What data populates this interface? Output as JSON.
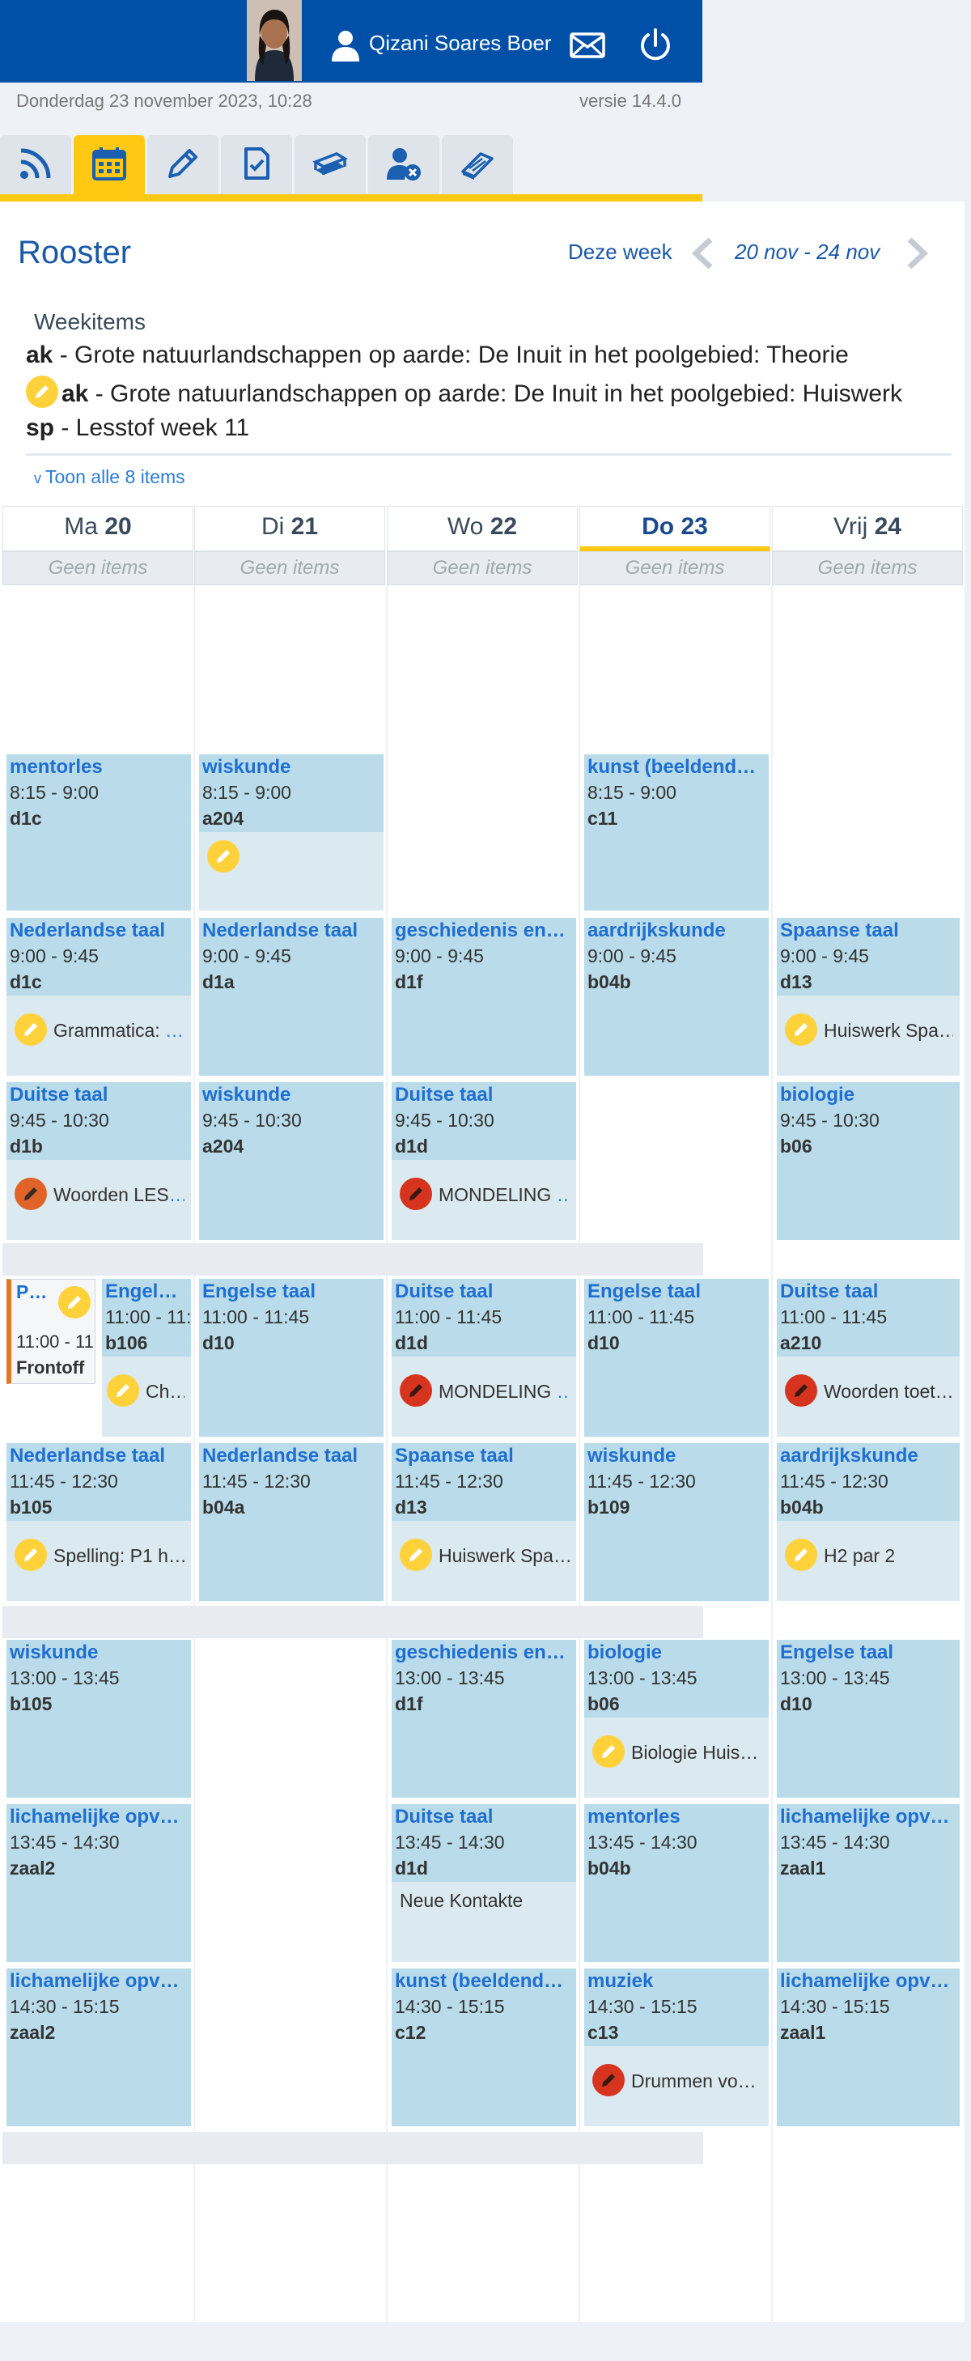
{
  "header": {
    "user_name": "Qizani Soares Boer",
    "date_time": "Donderdag 23 november 2023, 10:28",
    "version": "versie 14.4.0"
  },
  "nav_tabs": [
    {
      "icon": "rss-icon"
    },
    {
      "icon": "calendar-icon",
      "active": true
    },
    {
      "icon": "pencil-icon"
    },
    {
      "icon": "checklist-icon"
    },
    {
      "icon": "books-icon"
    },
    {
      "icon": "absence-icon"
    },
    {
      "icon": "book-icon"
    }
  ],
  "rooster": {
    "title": "Rooster",
    "this_week": "Deze week",
    "week_range": "20 nov - 24 nov"
  },
  "weekitems": {
    "heading": "Weekitems",
    "items": [
      {
        "code": "ak",
        "text": " - Grote natuurlandschappen op aarde: De Inuit in het poolgebied: Theorie"
      },
      {
        "code": "ak",
        "text": " - Grote natuurlandschappen op aarde: De Inuit in het poolgebied: Huiswerk"
      },
      {
        "code": "sp",
        "text": " - Lesstof week 11"
      }
    ],
    "show_all": "Toon alle 8 items"
  },
  "days": [
    {
      "abbr": "Ma",
      "num": "20",
      "noitems": "Geen items"
    },
    {
      "abbr": "Di",
      "num": "21",
      "noitems": "Geen items"
    },
    {
      "abbr": "Wo",
      "num": "22",
      "noitems": "Geen items"
    },
    {
      "abbr": "Do",
      "num": "23",
      "noitems": "Geen items"
    },
    {
      "abbr": "Vrij",
      "num": "24",
      "noitems": "Geen items"
    }
  ],
  "lessons": {
    "ma_1": {
      "subject": "mentorles",
      "time": "8:15 - 9:00",
      "room": "d1c"
    },
    "di_1": {
      "subject": "wiskunde",
      "time": "8:15 - 9:00",
      "room": "a204"
    },
    "do_1": {
      "subject": "kunst (beeldend…",
      "time": "8:15 - 9:00",
      "room": "c11"
    },
    "ma_2": {
      "subject": "Nederlandse taal",
      "time": "9:00 - 9:45",
      "room": "d1c",
      "hw": "Grammatica: ",
      "hw_ell": "…"
    },
    "di_2": {
      "subject": "Nederlandse taal",
      "time": "9:00 - 9:45",
      "room": "d1a"
    },
    "wo_2": {
      "subject": "geschiedenis en…",
      "time": "9:00 - 9:45",
      "room": "d1f"
    },
    "do_2": {
      "subject": "aardrijkskunde",
      "time": "9:00 - 9:45",
      "room": "b04b"
    },
    "vr_2": {
      "subject": "Spaanse taal",
      "time": "9:00 - 9:45",
      "room": "d13",
      "hw": "Huiswerk Spa…"
    },
    "ma_3": {
      "subject": "Duitse taal",
      "time": "9:45 - 10:30",
      "room": "d1b",
      "hw": "Woorden LES",
      "hw_ell": "…"
    },
    "di_3": {
      "subject": "wiskunde",
      "time": "9:45 - 10:30",
      "room": "a204"
    },
    "wo_3": {
      "subject": "Duitse taal",
      "time": "9:45 - 10:30",
      "room": "d1d",
      "hw": "MONDELING ",
      "hw_ell": "…"
    },
    "vr_3": {
      "subject": "biologie",
      "time": "9:45 - 10:30",
      "room": "b06"
    },
    "ma_4a": {
      "subject": "P…",
      "time": "11:00 - 11",
      "room": "Frontoff"
    },
    "ma_4b": {
      "subject": "Engels…",
      "time": "11:00 - 11:",
      "room": "b106",
      "hw": "Ch…"
    },
    "di_4": {
      "subject": "Engelse taal",
      "time": "11:00 - 11:45",
      "room": "d10"
    },
    "wo_4": {
      "subject": "Duitse taal",
      "time": "11:00 - 11:45",
      "room": "d1d",
      "hw": "MONDELING ",
      "hw_ell": "…"
    },
    "do_4": {
      "subject": "Engelse taal",
      "time": "11:00 - 11:45",
      "room": "d10"
    },
    "vr_4": {
      "subject": "Duitse taal",
      "time": "11:00 - 11:45",
      "room": "a210",
      "hw": "Woorden toet…"
    },
    "ma_5": {
      "subject": "Nederlandse taal",
      "time": "11:45 - 12:30",
      "room": "b105",
      "hw": "Spelling: P1 h…"
    },
    "di_5": {
      "subject": "Nederlandse taal",
      "time": "11:45 - 12:30",
      "room": "b04a"
    },
    "wo_5": {
      "subject": "Spaanse taal",
      "time": "11:45 - 12:30",
      "room": "d13",
      "hw": "Huiswerk Spa…"
    },
    "do_5": {
      "subject": "wiskunde",
      "time": "11:45 - 12:30",
      "room": "b109"
    },
    "vr_5": {
      "subject": "aardrijkskunde",
      "time": "11:45 - 12:30",
      "room": "b04b",
      "hw": "H2 par 2"
    },
    "ma_6": {
      "subject": "wiskunde",
      "time": "13:00 - 13:45",
      "room": "b105"
    },
    "wo_6": {
      "subject": "geschiedenis en…",
      "time": "13:00 - 13:45",
      "room": "d1f"
    },
    "do_6": {
      "subject": "biologie",
      "time": "13:00 - 13:45",
      "room": "b06",
      "hw": "Biologie Huis…"
    },
    "vr_6": {
      "subject": "Engelse taal",
      "time": "13:00 - 13:45",
      "room": "d10"
    },
    "ma_7": {
      "subject": "lichamelijke opv…",
      "time": "13:45 - 14:30",
      "room": "zaal2"
    },
    "wo_7": {
      "subject": "Duitse taal",
      "time": "13:45 - 14:30",
      "room": "d1d",
      "note": "Neue Kontakte"
    },
    "do_7": {
      "subject": "mentorles",
      "time": "13:45 - 14:30",
      "room": "b04b"
    },
    "vr_7": {
      "subject": "lichamelijke opv…",
      "time": "13:45 - 14:30",
      "room": "zaal1"
    },
    "ma_8": {
      "subject": "lichamelijke opv…",
      "time": "14:30 - 15:15",
      "room": "zaal2"
    },
    "wo_8": {
      "subject": "kunst (beeldend…",
      "time": "14:30 - 15:15",
      "room": "c12"
    },
    "do_8": {
      "subject": "muziek",
      "time": "14:30 - 15:15",
      "room": "c13",
      "hw": "Drummen vo…"
    },
    "vr_8": {
      "subject": "lichamelijke opv…",
      "time": "14:30 - 15:15",
      "room": "zaal1"
    }
  },
  "colors": {
    "brand_blue": "#0050a8",
    "accent_yellow": "#ffc913",
    "lesson_bg": "#b9dbea",
    "homework_bg": "#dbe9f0",
    "subject_blue": "#1f6fd0",
    "test_red": "#d6341e"
  }
}
